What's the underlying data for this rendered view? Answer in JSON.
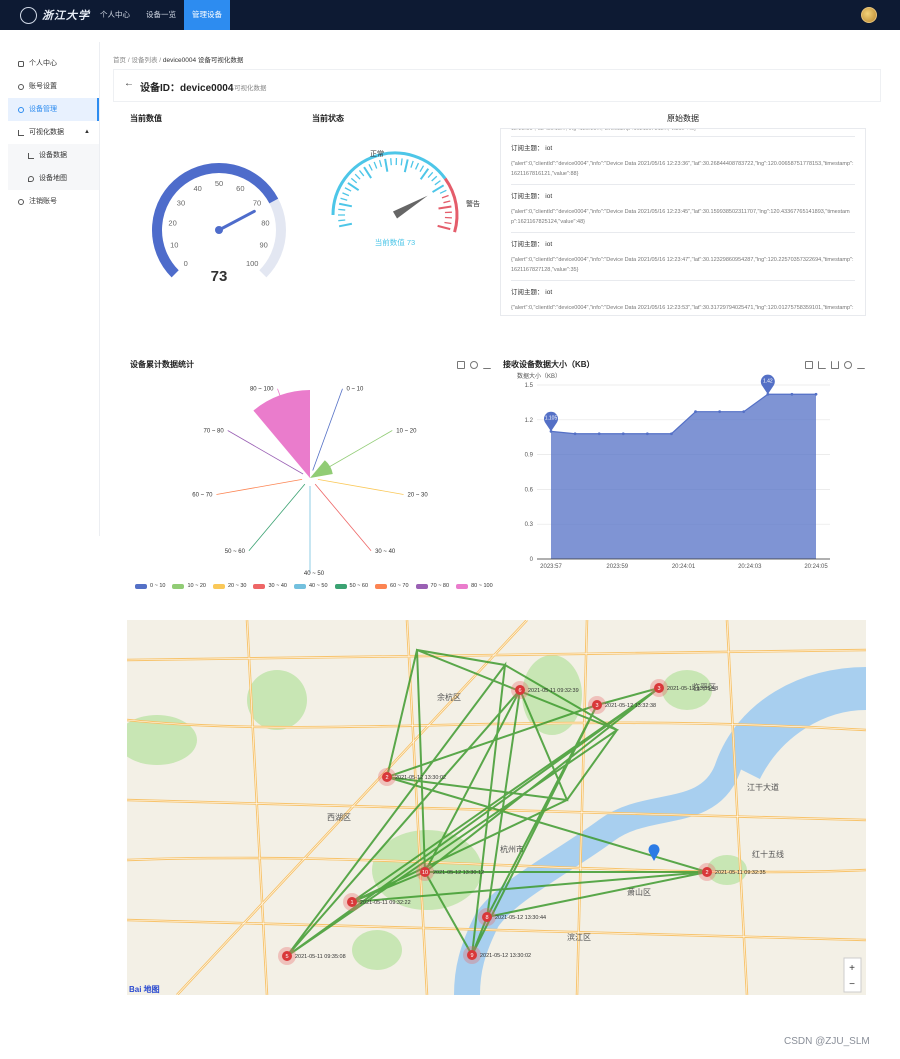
{
  "app": {
    "logo_text": "浙江大学",
    "nav": [
      "个人中心",
      "设备一览",
      "管理设备"
    ],
    "nav_active": 2
  },
  "sidebar": {
    "items": [
      {
        "label": "个人中心",
        "icon": "user-icon"
      },
      {
        "label": "账号设置",
        "icon": "gear-icon"
      },
      {
        "label": "设备管理",
        "icon": "device-icon",
        "active": true
      },
      {
        "label": "可视化数据",
        "icon": "chart-icon",
        "expanded": true
      },
      {
        "label": "设备数据",
        "icon": "line-chart-icon",
        "sub": true
      },
      {
        "label": "设备地图",
        "icon": "map-pin-icon",
        "sub": true
      },
      {
        "label": "注销账号",
        "icon": "logout-icon"
      }
    ]
  },
  "breadcrumb": {
    "home": "首页",
    "sep": "/",
    "list": "设备列表",
    "current": "device0004 设备可视化数据"
  },
  "header": {
    "title": "设备ID：device0004",
    "subtitle": "可视化数据"
  },
  "panels": {
    "current_value_title": "当前数值",
    "current_status_title": "当前状态",
    "raw_title": "原始数据",
    "rose_title": "设备累计数据统计",
    "area_title": "接收设备数据大小（KB）"
  },
  "gauge_value": {
    "value": 73,
    "min": 0,
    "max": 100,
    "ticks": [
      "0",
      "10",
      "20",
      "30",
      "40",
      "50",
      "60",
      "70",
      "80",
      "90",
      "100"
    ],
    "color_fill": "#4e6ccb",
    "color_track": "#e3e7f2"
  },
  "gauge_status": {
    "value": 73,
    "label_normal": "正常",
    "label_alert": "警告",
    "caption": "当前数值 73",
    "color_normal": "#4dc6e8",
    "color_alert": "#e45d6b"
  },
  "raw_data": {
    "partial_top": "12:23:31\",\"lat\":30.18...,\"lng\":120.20...,\"timestamp\":1621167811...,\"value\":40}",
    "entries": [
      {
        "topic": "订阅主题： iot",
        "json": "{\"alert\":0,\"clientId\":\"device0004\",\"info\":\"Device Data 2021/05/16 12:23:36\",\"lat\":30.26844408783722,\"lng\":120.00658751778153,\"timestamp\":1621167816121,\"value\":88}"
      },
      {
        "topic": "订阅主题： iot",
        "json": "{\"alert\":0,\"clientId\":\"device0004\",\"info\":\"Device Data 2021/05/16 12:23:45\",\"lat\":30.159938502311707,\"lng\":120.43367765141893,\"timestamp\":1621167825124,\"value\":48}"
      },
      {
        "topic": "订阅主题： iot",
        "json": "{\"alert\":0,\"clientId\":\"device0004\",\"info\":\"Device Data 2021/05/16 12:23:47\",\"lat\":30.12329860954287,\"lng\":120.22570357322694,\"timestamp\":1621167827128,\"value\":35}"
      },
      {
        "topic": "订阅主题： iot",
        "json": "{\"alert\":0,\"clientId\":\"device0004\",\"info\":\"Device Data 2021/05/16 12:23:53\",\"lat\":30.31729794025471,\"lng\":120.01275758359101,\"timestamp\":1621167833129,\"value\":37}"
      }
    ]
  },
  "chart_data": [
    {
      "type": "pie",
      "subtype": "nightingale-rose",
      "title": "设备累计数据统计",
      "categories": [
        "0 ~ 10",
        "10 ~ 20",
        "20 ~ 30",
        "30 ~ 40",
        "40 ~ 50",
        "50 ~ 60",
        "60 ~ 70",
        "70 ~ 80",
        "80 ~ 100"
      ],
      "values": [
        0,
        2,
        0,
        0,
        0,
        0,
        0,
        0,
        18
      ],
      "colors": [
        "#5470c6",
        "#91cc75",
        "#fac858",
        "#ee6666",
        "#73c0de",
        "#3ba272",
        "#fc8452",
        "#9a60b4",
        "#ea7ccc"
      ],
      "legend_position": "bottom"
    },
    {
      "type": "area",
      "title": "接收设备数据大小（KB）",
      "ylabel": "数据大小（KB）",
      "x": [
        "2023:57",
        "",
        "",
        "",
        "",
        "2023:59",
        "",
        "",
        "",
        "",
        "20:24:01",
        "",
        "",
        "",
        "",
        "20:24:03",
        "",
        "",
        "",
        "",
        "20:24:05",
        ""
      ],
      "x_tick_labels": [
        "2023:57",
        "2023:59",
        "20:24:01",
        "20:24:03",
        "20:24:05"
      ],
      "values": [
        1.1,
        1.08,
        1.08,
        1.08,
        1.08,
        1.08,
        1.27,
        1.27,
        1.27,
        1.42,
        1.42,
        1.42
      ],
      "ylim": [
        0,
        1.5
      ],
      "y_ticks": [
        "0",
        "0.3",
        "0.6",
        "0.9",
        "1.2",
        "1.5"
      ],
      "markers": [
        {
          "label": "1.105",
          "index": 0
        },
        {
          "label": "1.42",
          "index": 9
        }
      ],
      "color": "#5470c6",
      "grid": true
    }
  ],
  "map": {
    "labels": [
      {
        "text": "杭州市"
      },
      {
        "text": "江干大道"
      },
      {
        "text": "红十五线"
      },
      {
        "text": "临平区"
      },
      {
        "text": "萧山区"
      },
      {
        "text": "滨江区"
      },
      {
        "text": "西湖区"
      },
      {
        "text": "余杭区"
      }
    ],
    "markers": [
      {
        "count": "1",
        "label": "2021-05-11 09:32:22"
      },
      {
        "count": "2",
        "label": "2021-05-11 09:32:35"
      },
      {
        "count": "2",
        "label": "2021-05-12 13:30:02"
      },
      {
        "count": "3",
        "label": "2021-05-12 13:32:38"
      },
      {
        "count": "3",
        "label": "2021-05-12 13:35:48"
      },
      {
        "count": "5",
        "label": "2021-05-11 09:35:08"
      },
      {
        "count": "6",
        "label": "2021-05-11 09:32:39"
      },
      {
        "count": "8",
        "label": "2021-05-12 13:30:44"
      },
      {
        "count": "9",
        "label": "2021-05-12 13:30:02"
      },
      {
        "count": "10",
        "label": "2021-05-12 13:30:12"
      }
    ],
    "zoom_in": "+",
    "zoom_out": "−",
    "logo": "Bai 地图"
  },
  "watermark": "CSDN @ZJU_SLM"
}
